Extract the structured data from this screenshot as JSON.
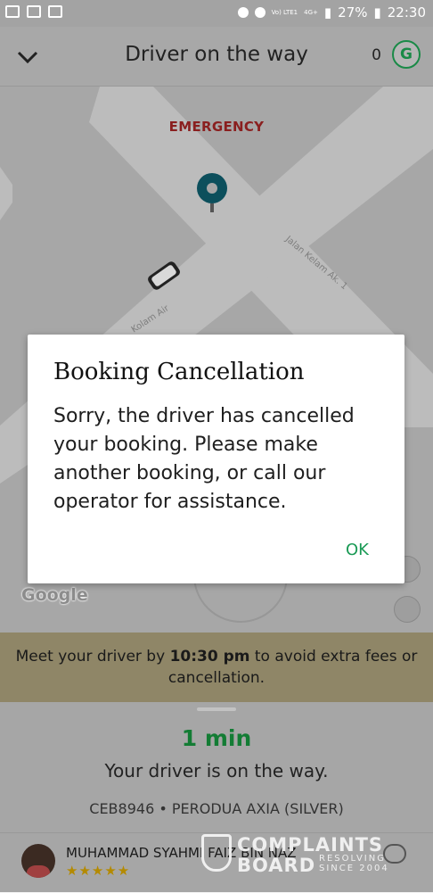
{
  "status_bar": {
    "battery": "27%",
    "time": "22:30",
    "network_top": "Vo) LTE1",
    "network_right": "4G+"
  },
  "header": {
    "title": "Driver on the way",
    "points_count": "0",
    "badge_letter": "G"
  },
  "map": {
    "emergency_label": "EMERGENCY",
    "street_1": "Jalan Kelam Ak. 1",
    "street_2": "Kolam Air",
    "provider": "Google"
  },
  "dialog": {
    "title": "Booking Cancellation",
    "message": "Sorry, the driver has cancelled your booking. Please make another booking, or call our operator for assistance.",
    "ok_label": "OK"
  },
  "banner": {
    "before": "Meet your driver by ",
    "time": "10:30 pm",
    "after": " to avoid extra fees or cancellation."
  },
  "trip": {
    "eta": "1 min",
    "status": "Your driver is on the way.",
    "vehicle": "CEB8946 • PERODUA AXIA (SILVER)"
  },
  "driver": {
    "name": "MUHAMMAD SYAHMI FAIZ BIN NAZ",
    "stars": "★★★★★"
  },
  "watermark": {
    "line1": "COMPLAINTS",
    "line2": "BOARD",
    "tag1": "RESOLVING",
    "tag2": "SINCE 2004"
  },
  "colors": {
    "accent_green": "#1a9a55",
    "emergency_red": "#8a1f1f",
    "banner_bg": "#8f8667"
  }
}
